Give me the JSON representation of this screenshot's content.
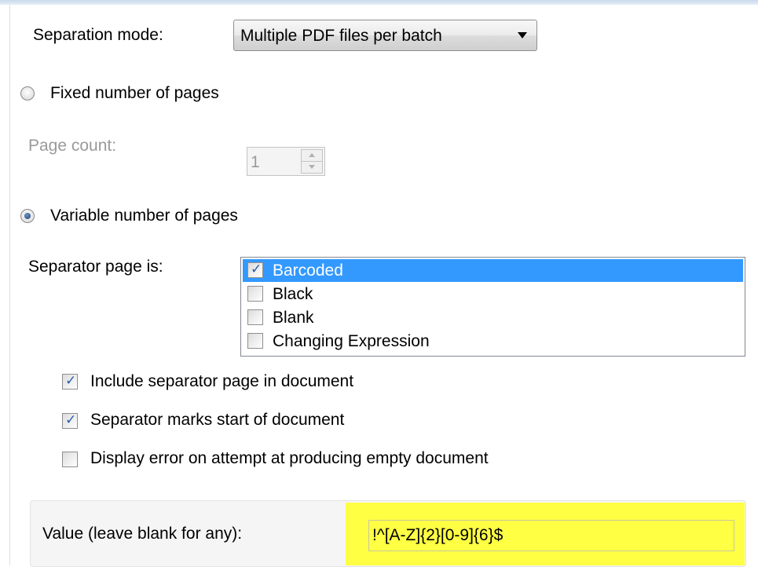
{
  "separation_mode": {
    "label": "Separation mode:",
    "selected": "Multiple PDF files per batch"
  },
  "fixed_pages": {
    "label": "Fixed number of pages",
    "selected": false,
    "page_count_label": "Page count:",
    "page_count_value": "1"
  },
  "variable_pages": {
    "label": "Variable number of pages",
    "selected": true
  },
  "separator": {
    "label": "Separator page is:",
    "items": [
      {
        "label": "Barcoded",
        "checked": true,
        "selected": true
      },
      {
        "label": "Black",
        "checked": false,
        "selected": false
      },
      {
        "label": "Blank",
        "checked": false,
        "selected": false
      },
      {
        "label": "Changing Expression",
        "checked": false,
        "selected": false
      }
    ]
  },
  "options": [
    {
      "label": "Include separator page in document",
      "checked": true
    },
    {
      "label": "Separator marks start of document",
      "checked": true
    },
    {
      "label": "Display error on attempt at producing empty document",
      "checked": false
    }
  ],
  "value": {
    "label": "Value (leave blank for any):",
    "input_value": "!^[A-Z]{2}[0-9]{6}$"
  },
  "colors": {
    "highlight": "#ffff44",
    "selection": "#3399ff"
  }
}
